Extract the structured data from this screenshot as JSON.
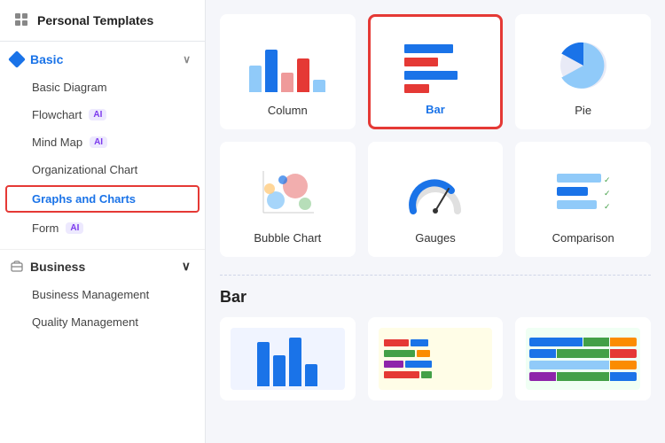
{
  "sidebar": {
    "header_label": "Personal Templates",
    "header_icon": "grid",
    "groups": [
      {
        "id": "basic",
        "label": "Basic",
        "color": "#1a73e8",
        "expanded": true,
        "items": [
          {
            "id": "basic-diagram",
            "label": "Basic Diagram",
            "ai": false,
            "active": false
          },
          {
            "id": "flowchart",
            "label": "Flowchart",
            "ai": true,
            "active": false
          },
          {
            "id": "mind-map",
            "label": "Mind Map",
            "ai": true,
            "active": false
          },
          {
            "id": "org-chart",
            "label": "Organizational Chart",
            "ai": false,
            "active": false
          },
          {
            "id": "graphs-charts",
            "label": "Graphs and Charts",
            "ai": false,
            "active": true
          },
          {
            "id": "form",
            "label": "Form",
            "ai": true,
            "active": false
          }
        ]
      },
      {
        "id": "business",
        "label": "Business",
        "color": "#333",
        "expanded": true,
        "items": [
          {
            "id": "business-mgmt",
            "label": "Business Management",
            "ai": false,
            "active": false
          },
          {
            "id": "quality-mgmt",
            "label": "Quality Management",
            "ai": false,
            "active": false
          }
        ]
      }
    ]
  },
  "main": {
    "selected_card": "bar",
    "section_title": "Bar",
    "cards": [
      {
        "id": "column",
        "label": "Column",
        "selected": false
      },
      {
        "id": "bar",
        "label": "Bar",
        "selected": true
      },
      {
        "id": "pie",
        "label": "Pie",
        "selected": false
      },
      {
        "id": "bubble",
        "label": "Bubble Chart",
        "selected": false
      },
      {
        "id": "gauges",
        "label": "Gauges",
        "selected": false
      },
      {
        "id": "comparison",
        "label": "Comparison",
        "selected": false
      }
    ],
    "bottom_cards": [
      {
        "id": "bar-thumb-1",
        "label": ""
      },
      {
        "id": "bar-thumb-2",
        "label": ""
      },
      {
        "id": "bar-thumb-3",
        "label": ""
      }
    ]
  },
  "ai_badge_label": "AI",
  "chevron_down": "∨"
}
